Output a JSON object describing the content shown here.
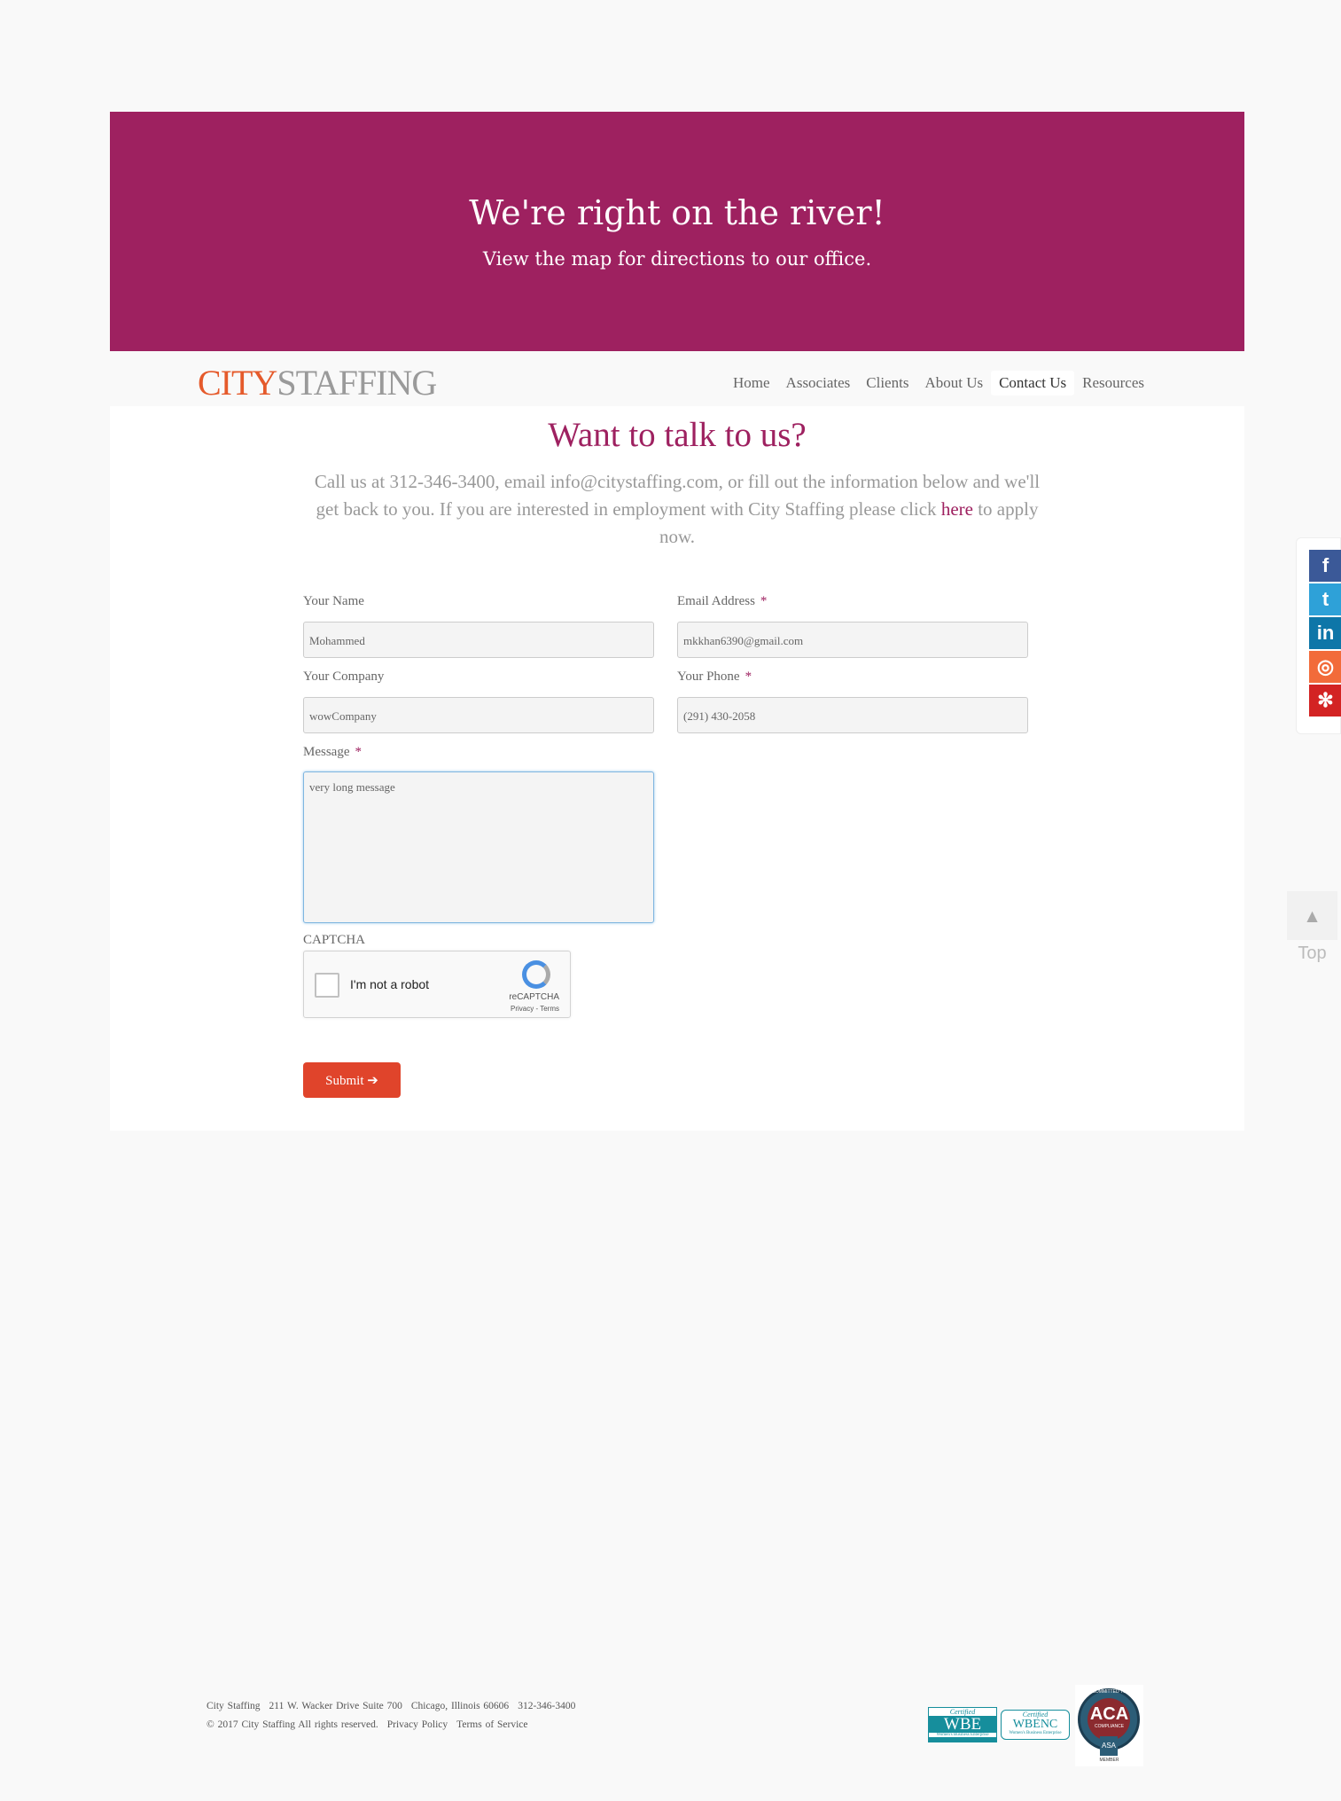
{
  "banner": {
    "title": "We're right on the river!",
    "subtitle": "View the map for directions to our office."
  },
  "logo": {
    "city": "CITY",
    "staffing": "STAFFING"
  },
  "nav": {
    "items": [
      {
        "label": "Home"
      },
      {
        "label": "Associates"
      },
      {
        "label": "Clients"
      },
      {
        "label": "About Us"
      },
      {
        "label": "Contact Us",
        "active": true
      },
      {
        "label": "Resources"
      }
    ]
  },
  "main": {
    "title": "Want to talk to us?",
    "intro_before": "Call us at 312-346-3400, email info@citystaffing.com, or fill out the information below and we'll get back to you. If you are interested in employment with City Staffing please click ",
    "intro_link": "here",
    "intro_after": " to apply now."
  },
  "form": {
    "name": {
      "label": "Your Name",
      "value": "Mohammed"
    },
    "email": {
      "label": "Email Address",
      "value": "mkkhan6390@gmail.com",
      "required": "*"
    },
    "company": {
      "label": "Your Company",
      "value": "wowCompany"
    },
    "phone": {
      "label": "Your Phone",
      "value": "(291) 430-2058",
      "required": "*"
    },
    "message": {
      "label": "Message",
      "value": "very long message",
      "required": "*"
    },
    "captcha_label": "CAPTCHA",
    "recaptcha": {
      "text": "I'm not a robot",
      "brand": "reCAPTCHA",
      "links": "Privacy - Terms"
    },
    "submit": "Submit"
  },
  "social": {
    "items": [
      {
        "icon": "facebook-icon",
        "glyph": "f",
        "color": "#3b5998"
      },
      {
        "icon": "twitter-icon",
        "glyph": "t",
        "color": "#2ea1d8"
      },
      {
        "icon": "linkedin-icon",
        "glyph": "in",
        "color": "#0e76a8"
      },
      {
        "icon": "instagram-icon",
        "glyph": "◎",
        "color": "#f26b3a"
      },
      {
        "icon": "yelp-icon",
        "glyph": "✻",
        "color": "#d32323"
      }
    ]
  },
  "top_button": {
    "label": "Top"
  },
  "footer": {
    "company": "City Staffing",
    "address": "211 W. Wacker Drive Suite 700",
    "city": "Chicago, Illinois 60606",
    "phone": "312-346-3400",
    "copyright": "© 2017 City Staffing All rights reserved.",
    "privacy": "Privacy Policy",
    "terms": "Terms of Service",
    "badges": {
      "wbe_certified": "Certified",
      "wbe": "WBE",
      "wbe_sub": "Women's Business Enterprise",
      "wbenc_certified": "Certified",
      "wbenc": "WBENC",
      "wbenc_sub": "Women's Business Enterprise",
      "aca_top": "COMMITTED TO",
      "aca": "ACA",
      "aca_sub": "COMPLIANCE",
      "asa": "ASA",
      "member": "MEMBER"
    }
  }
}
